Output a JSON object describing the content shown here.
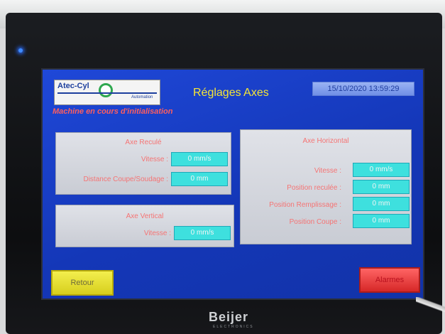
{
  "header": {
    "logo_text": "Atec-Cyl",
    "logo_sub": "Automation",
    "title": "Réglages Axes",
    "datetime": "15/10/2020 13:59:29"
  },
  "status_message": "Machine en cours d'initialisation",
  "panels": {
    "recul": {
      "title": "Axe Reculé",
      "speed_label": "Vitesse :",
      "speed_value": "0 mm/s",
      "distance_label": "Distance Coupe/Soudage :",
      "distance_value": "0 mm"
    },
    "vertical": {
      "title": "Axe Vertical",
      "speed_label": "Vitesse :",
      "speed_value": "0 mm/s"
    },
    "horizontal": {
      "title": "Axe Horizontal",
      "speed_label": "Vitesse :",
      "speed_value": "0 mm/s",
      "pos_reculee_label": "Position reculée :",
      "pos_reculee_value": "0 mm",
      "pos_remplissage_label": "Position Remplissage :",
      "pos_remplissage_value": "0 mm",
      "pos_coupe_label": "Position Coupe :",
      "pos_coupe_value": "0 mm"
    }
  },
  "buttons": {
    "back": "Retour",
    "alarms": "Alarmes"
  },
  "device_brand": "Beijer",
  "device_brand_sub": "ELECTRONICS",
  "colors": {
    "screen_bg": "#1437b8",
    "title": "#f6e635",
    "label_red": "#f57474",
    "value_cyan": "#3ee0de",
    "back_button": "#e8e23a",
    "alarm_button": "#e53a3a"
  }
}
